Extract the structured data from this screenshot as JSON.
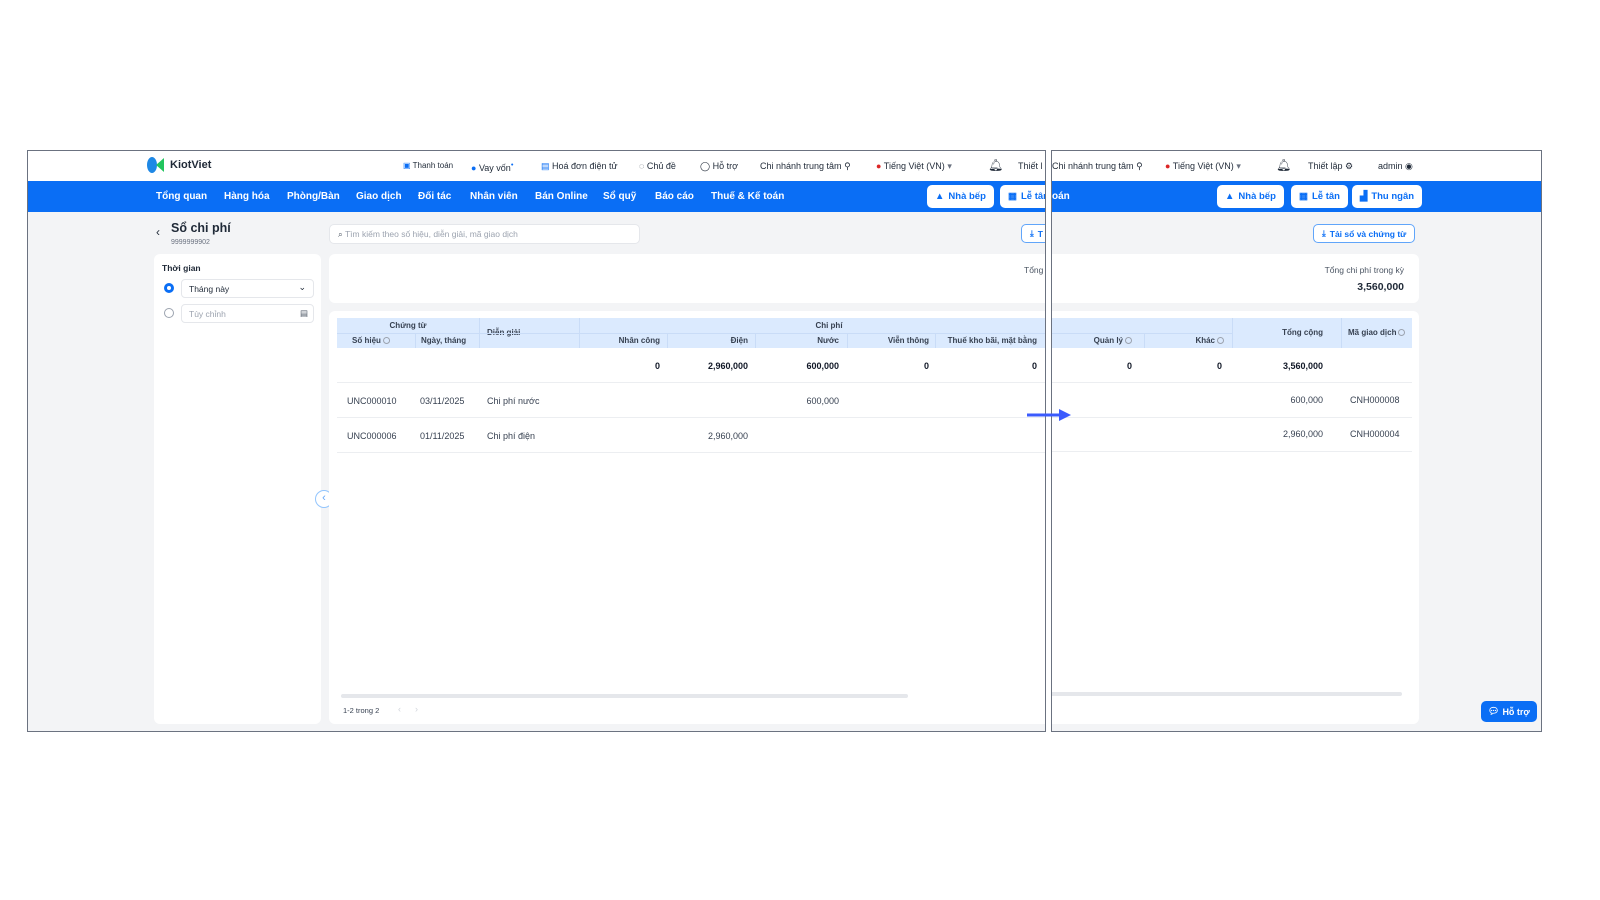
{
  "app": {
    "logo": "KiotViet"
  },
  "header": {
    "payment": "Thanh toán",
    "loan": "Vay vốn",
    "einvoice": "Hoá đơn điện tử",
    "theme": "Chủ đề",
    "support": "Hỗ trợ",
    "branch": "Chi nhánh trung tâm",
    "language": "Tiếng Việt (VN)",
    "settings_cut": "Thiết l",
    "settings": "Thiết lập",
    "user": "admin"
  },
  "nav": {
    "items": [
      "Tổng quan",
      "Hàng hóa",
      "Phòng/Bàn",
      "Giao dịch",
      "Đối tác",
      "Nhân viên",
      "Bán Online",
      "Sổ quỹ",
      "Báo cáo",
      "Thuế & Kế toán"
    ],
    "tax_cut": "oán",
    "kitchen": "Nhà bếp",
    "reception": "Lễ tân",
    "cashier": "Thu ngân"
  },
  "page": {
    "title": "Sổ chi phí",
    "subtitle": "9999999902",
    "search_placeholder": "Tìm kiếm theo số hiệu, diễn giải, mã giao dịch",
    "download": "Tải sổ và chứng từ",
    "download_cut": "T"
  },
  "filter": {
    "label": "Thời gian",
    "preset": "Tháng này",
    "custom_placeholder": "Tùy chỉnh"
  },
  "summary": {
    "label": "Tổng chi phí trong kỳ",
    "label_cut": "Tổng",
    "value": "3,560,000"
  },
  "table": {
    "group_voucher": "Chứng từ",
    "group_cost": "Chi phí",
    "headers": {
      "number": "Số hiệu",
      "date": "Ngày, tháng",
      "desc": "Diễn giải",
      "labor": "Nhân công",
      "electric": "Điện",
      "water": "Nước",
      "telecom": "Viễn thông",
      "rent": "Thuế kho bãi, mặt bằng",
      "manage": "Quản lý",
      "other": "Khác",
      "total": "Tổng cộng",
      "txn": "Mã giao dịch"
    },
    "totals": {
      "labor": "0",
      "electric": "2,960,000",
      "water": "600,000",
      "telecom": "0",
      "rent": "0",
      "manage": "0",
      "other": "0",
      "total": "3,560,000"
    },
    "rows": [
      {
        "number": "UNC000010",
        "date": "03/11/2025",
        "desc": "Chi phí nước",
        "electric": "",
        "water": "600,000",
        "total": "600,000",
        "txn": "CNH000008"
      },
      {
        "number": "UNC000006",
        "date": "01/11/2025",
        "desc": "Chi phí điện",
        "electric": "2,960,000",
        "water": "",
        "total": "2,960,000",
        "txn": "CNH000004"
      }
    ]
  },
  "pagination": {
    "text": "1-2 trong 2"
  },
  "help": {
    "label": "Hỗ trợ"
  },
  "colors": {
    "brand": "#0a6ef5",
    "header_bg": "#dbeafe",
    "arrow": "#3b5bfd"
  }
}
